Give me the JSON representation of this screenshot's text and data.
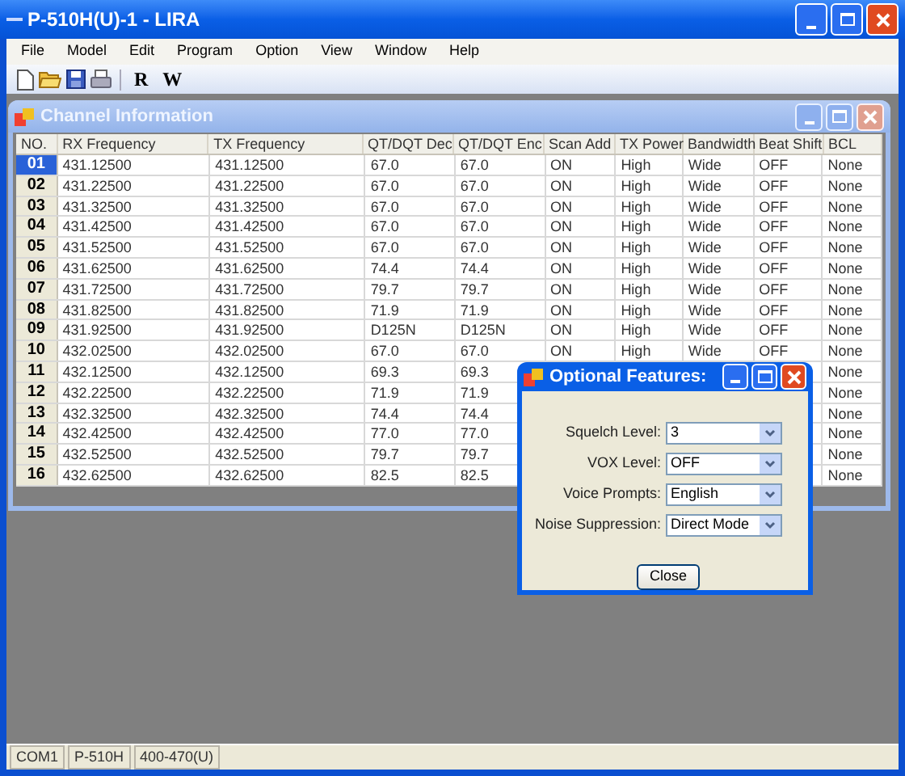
{
  "window": {
    "title": "P-510H(U)-1 - LIRA"
  },
  "menu": [
    "File",
    "Model",
    "Edit",
    "Program",
    "Option",
    "View",
    "Window",
    "Help"
  ],
  "toolbar": [
    {
      "kind": "new"
    },
    {
      "kind": "open"
    },
    {
      "kind": "save"
    },
    {
      "kind": "print"
    },
    {
      "kind": "separator"
    },
    {
      "kind": "text",
      "label": "R"
    },
    {
      "kind": "text",
      "label": "W"
    }
  ],
  "child_window": {
    "title": "Channel Information",
    "table": {
      "columns": [
        "NO.",
        "RX Frequency",
        "TX Frequency",
        "QT/DQT Dec",
        "QT/DQT Enc",
        "Scan Add",
        "TX Power",
        "Bandwidth",
        "Beat Shift",
        "BCL"
      ],
      "rows": [
        {
          "selected": true,
          "cells": [
            "01",
            "431.12500",
            "431.12500",
            "67.0",
            "67.0",
            "ON",
            "High",
            "Wide",
            "OFF",
            "None"
          ]
        },
        {
          "selected": false,
          "cells": [
            "02",
            "431.22500",
            "431.22500",
            "67.0",
            "67.0",
            "ON",
            "High",
            "Wide",
            "OFF",
            "None"
          ]
        },
        {
          "selected": false,
          "cells": [
            "03",
            "431.32500",
            "431.32500",
            "67.0",
            "67.0",
            "ON",
            "High",
            "Wide",
            "OFF",
            "None"
          ]
        },
        {
          "selected": false,
          "cells": [
            "04",
            "431.42500",
            "431.42500",
            "67.0",
            "67.0",
            "ON",
            "High",
            "Wide",
            "OFF",
            "None"
          ]
        },
        {
          "selected": false,
          "cells": [
            "05",
            "431.52500",
            "431.52500",
            "67.0",
            "67.0",
            "ON",
            "High",
            "Wide",
            "OFF",
            "None"
          ]
        },
        {
          "selected": false,
          "cells": [
            "06",
            "431.62500",
            "431.62500",
            "74.4",
            "74.4",
            "ON",
            "High",
            "Wide",
            "OFF",
            "None"
          ]
        },
        {
          "selected": false,
          "cells": [
            "07",
            "431.72500",
            "431.72500",
            "79.7",
            "79.7",
            "ON",
            "High",
            "Wide",
            "OFF",
            "None"
          ]
        },
        {
          "selected": false,
          "cells": [
            "08",
            "431.82500",
            "431.82500",
            "71.9",
            "71.9",
            "ON",
            "High",
            "Wide",
            "OFF",
            "None"
          ]
        },
        {
          "selected": false,
          "cells": [
            "09",
            "431.92500",
            "431.92500",
            "D125N",
            "D125N",
            "ON",
            "High",
            "Wide",
            "OFF",
            "None"
          ]
        },
        {
          "selected": false,
          "cells": [
            "10",
            "432.02500",
            "432.02500",
            "67.0",
            "67.0",
            "ON",
            "High",
            "Wide",
            "OFF",
            "None"
          ]
        },
        {
          "selected": false,
          "cells": [
            "11",
            "432.12500",
            "432.12500",
            "69.3",
            "69.3",
            "",
            "",
            "",
            "",
            "None"
          ]
        },
        {
          "selected": false,
          "cells": [
            "12",
            "432.22500",
            "432.22500",
            "71.9",
            "71.9",
            "",
            "",
            "",
            "",
            "None"
          ]
        },
        {
          "selected": false,
          "cells": [
            "13",
            "432.32500",
            "432.32500",
            "74.4",
            "74.4",
            "",
            "",
            "",
            "",
            "None"
          ]
        },
        {
          "selected": false,
          "cells": [
            "14",
            "432.42500",
            "432.42500",
            "77.0",
            "77.0",
            "",
            "",
            "",
            "",
            "None"
          ]
        },
        {
          "selected": false,
          "cells": [
            "15",
            "432.52500",
            "432.52500",
            "79.7",
            "79.7",
            "",
            "",
            "",
            "",
            "None"
          ]
        },
        {
          "selected": false,
          "cells": [
            "16",
            "432.62500",
            "432.62500",
            "82.5",
            "82.5",
            "",
            "",
            "",
            "",
            "None"
          ]
        }
      ]
    }
  },
  "dialog": {
    "title": "Optional Features:",
    "fields": [
      {
        "label": "Squelch Level:",
        "value": "3"
      },
      {
        "label": "VOX Level:",
        "value": "OFF"
      },
      {
        "label": "Voice Prompts:",
        "value": "English"
      },
      {
        "label": "Noise Suppression:",
        "value": "Direct Mode"
      }
    ],
    "button": "Close"
  },
  "status_bar": [
    "COM1",
    "P-510H",
    "400-470(U)"
  ]
}
